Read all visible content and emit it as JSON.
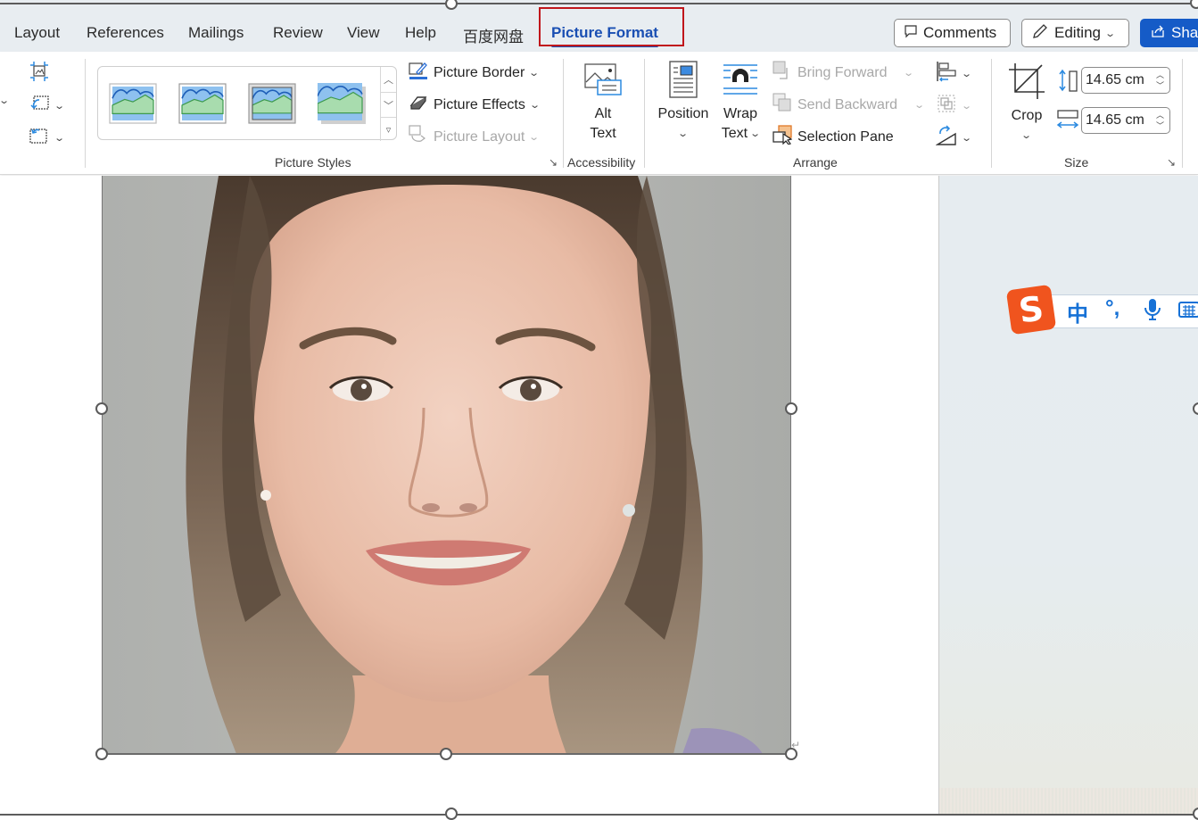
{
  "tabs": [
    {
      "label": "Layout",
      "active": false
    },
    {
      "label": "References",
      "active": false
    },
    {
      "label": "Mailings",
      "active": false
    },
    {
      "label": "Review",
      "active": false
    },
    {
      "label": "View",
      "active": false
    },
    {
      "label": "Help",
      "active": false
    },
    {
      "label": "百度网盘",
      "active": false
    },
    {
      "label": "Picture Format",
      "active": true
    }
  ],
  "top_buttons": {
    "comments": "Comments",
    "editing": "Editing",
    "share": "Shar"
  },
  "ribbon": {
    "picture_styles": {
      "label": "Picture Styles",
      "gallery_items": [
        "Simple Frame, White",
        "Simple Frame, Black",
        "Beveled Matte, White",
        "Drop Shadow Rectangle"
      ],
      "picture_border": "Picture Border",
      "picture_effects": "Picture Effects",
      "picture_layout": "Picture Layout"
    },
    "accessibility": {
      "label": "Accessibility",
      "alt_text_line1": "Alt",
      "alt_text_line2": "Text"
    },
    "arrange": {
      "label": "Arrange",
      "position": "Position",
      "wrap_line1": "Wrap",
      "wrap_line2": "Text",
      "bring_forward": "Bring Forward",
      "send_backward": "Send Backward",
      "selection_pane": "Selection Pane"
    },
    "size": {
      "label": "Size",
      "crop": "Crop",
      "height_value": "14.65 cm",
      "width_value": "14.65 cm"
    }
  },
  "ime": {
    "mode": "中",
    "punct": "°,",
    "logo": "S"
  },
  "colors": {
    "accent": "#1a4fb3",
    "share_bg": "#155bc7",
    "highlight_box": "#c0161b",
    "ime_orange": "#f0541e",
    "ime_blue": "#1671d6"
  }
}
